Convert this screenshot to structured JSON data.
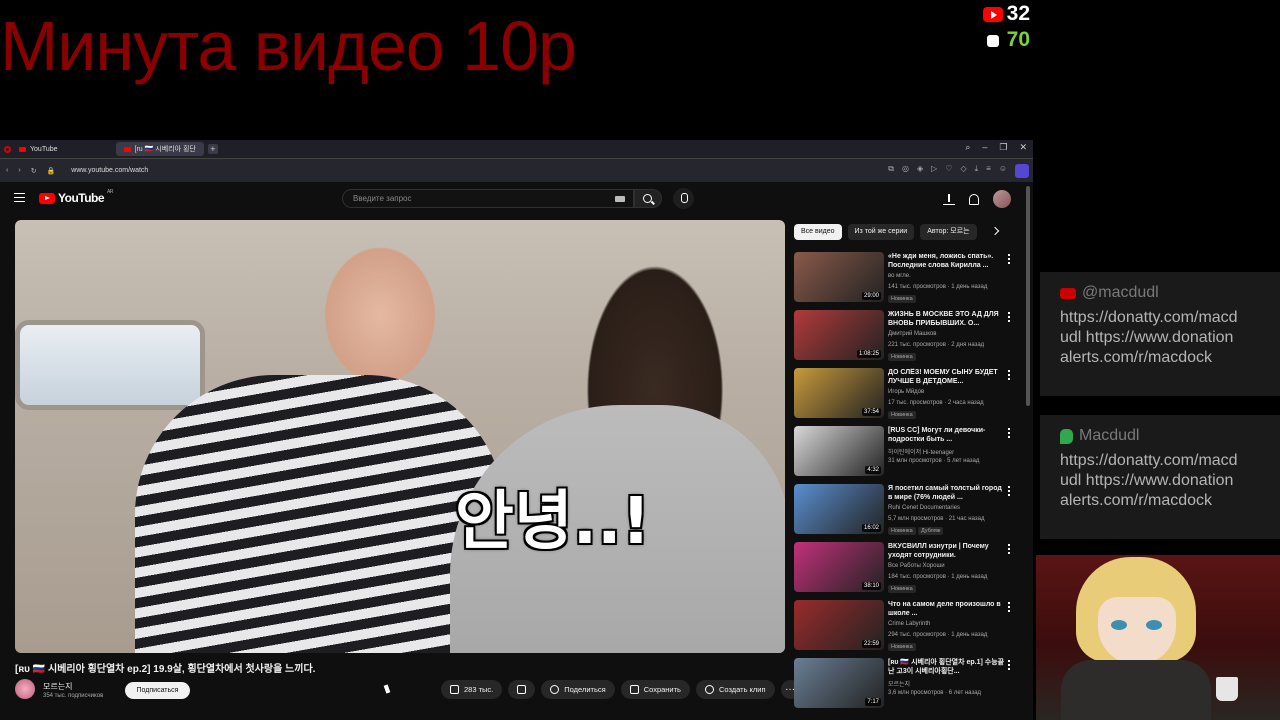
{
  "overlay": {
    "title": "Минута видео 10р",
    "youtube_viewers": "32",
    "donationalerts_count": "70"
  },
  "browser": {
    "tabs": [
      {
        "label": "YouTube"
      },
      {
        "label": "[ru 🇷🇺 시베리아 횡단"
      }
    ],
    "url": "www.youtube.com/watch"
  },
  "youtube": {
    "logo_text": "YouTube",
    "logo_region": "AR",
    "search_placeholder": "Введите запрос",
    "video": {
      "subtitle": "안녕..!",
      "title": "[ʀᴜ 🇷🇺 시베리아 횡단열차 ep.2] 19.9살, 횡단열차에서 첫사랑을 느끼다.",
      "channel": "모르는지",
      "subscribers": "354 тыс. подписчиков",
      "subscribe_label": "Подписаться",
      "likes": "283 тыс.",
      "share_label": "Поделиться",
      "save_label": "Сохранить",
      "clip_label": "Создать клип",
      "more_label": "···"
    },
    "chips": [
      "Все видео",
      "Из той же серии",
      "Автор: 모르는"
    ],
    "recommendations": [
      {
        "title": "«Не жди меня, ложись спать». Последние слова Кирилла ...",
        "channel": "во мгле.",
        "meta": "141 тыс. просмотров · 1 день назад",
        "badge": "Новинка",
        "duration": "29:00",
        "thumb_color": "#8a5a4a"
      },
      {
        "title": "ЖИЗНЬ В МОСКВЕ ЭТО АД ДЛЯ ВНОВЬ ПРИБЫВШИХ. О...",
        "channel": "Дмитрий Машков",
        "meta": "221 тыс. просмотров · 2 дня назад",
        "badge": "Новинка",
        "duration": "1:08:25",
        "thumb_color": "#b23a3a"
      },
      {
        "title": "ДО СЛЁЗ! МОЕМУ СЫНУ БУДЕТ ЛУЧШЕ В ДЕТДОМЕ...",
        "channel": "Игорь Мйдов",
        "meta": "17 тыс. просмотров · 2 часа назад",
        "badge": "Новинка",
        "duration": "37:54",
        "thumb_color": "#c89a3c"
      },
      {
        "title": "[RUS CC] Могут ли девочки-подростки быть ...",
        "channel": "하이틴에이저 Hi-teenager",
        "meta": "31 млн просмотров · 5 лет назад",
        "badge": "",
        "duration": "4:32",
        "thumb_color": "#d9d9d9"
      },
      {
        "title": "Я посетил самый толстый город в мире (76% людей ...",
        "channel": "Ruhi Cenet Documentaries",
        "meta": "5,7 млн просмотров · 21 час назад",
        "badge": "Новинка",
        "badge2": "Дубляж",
        "duration": "16:02",
        "thumb_color": "#5a8fd0"
      },
      {
        "title": "ВКУСВИЛЛ изнутри | Почему уходят сотрудники.",
        "channel": "Все Работы Хороши",
        "meta": "184 тыс. просмотров · 1 день назад",
        "badge": "Новинка",
        "duration": "38:10",
        "thumb_color": "#c2317a"
      },
      {
        "title": "Что на самом деле произошло в школе ...",
        "channel": "Crime Labyrinth",
        "meta": "294 тыс. просмотров · 1 день назад",
        "badge": "Новинка",
        "duration": "22:59",
        "thumb_color": "#9a2b2b"
      },
      {
        "title": "[ʀᴜ 🇷🇺 시베리아 횡단열차 ep.1] 수능끝난 고3이 시베리아횡단...",
        "channel": "모르는지",
        "meta": "3,6 млн просмотров · 6 лет назад",
        "badge": "",
        "duration": "7:17",
        "thumb_color": "#6a7f94"
      }
    ]
  },
  "stream_panel": {
    "youtube_user": "@macdudl",
    "youtube_links": "https://donatty.com/macdudl https://www.donationalerts.com/r/macdock",
    "da_user": "Macdudl",
    "da_links": "https://donatty.com/macdudl https://www.donationalerts.com/r/macdock"
  },
  "colors": {
    "overlay_title": "#8a0000",
    "youtube_red": "#ff0000",
    "donation_green": "#7fd13b"
  }
}
